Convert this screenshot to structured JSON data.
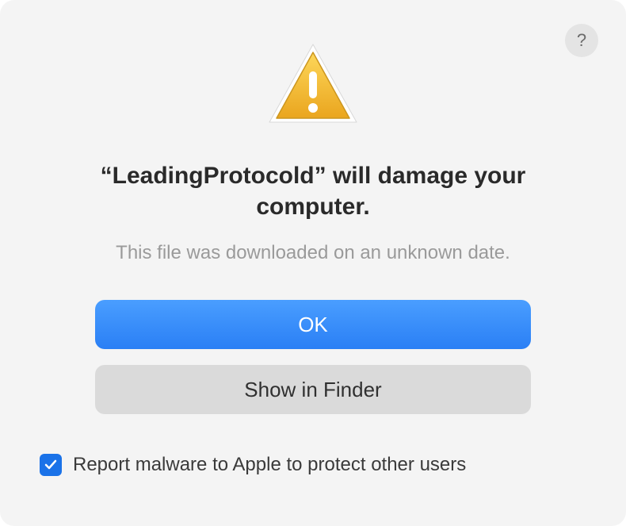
{
  "dialog": {
    "help_label": "?",
    "heading": "“LeadingProtocold” will damage your computer.",
    "subtext": "This file was downloaded on an unknown date.",
    "primary_button": "OK",
    "secondary_button": "Show in Finder",
    "checkbox_label": "Report malware to Apple to protect other users",
    "checkbox_checked": true
  },
  "icons": {
    "warning": "warning-triangle",
    "help": "question-mark",
    "checkmark": "checkmark"
  },
  "colors": {
    "primary_button": "#2a7ff5",
    "secondary_button": "#dadada",
    "checkbox": "#1a72e8",
    "warning_fill": "#f2b838",
    "warning_stroke": "#c99220"
  }
}
